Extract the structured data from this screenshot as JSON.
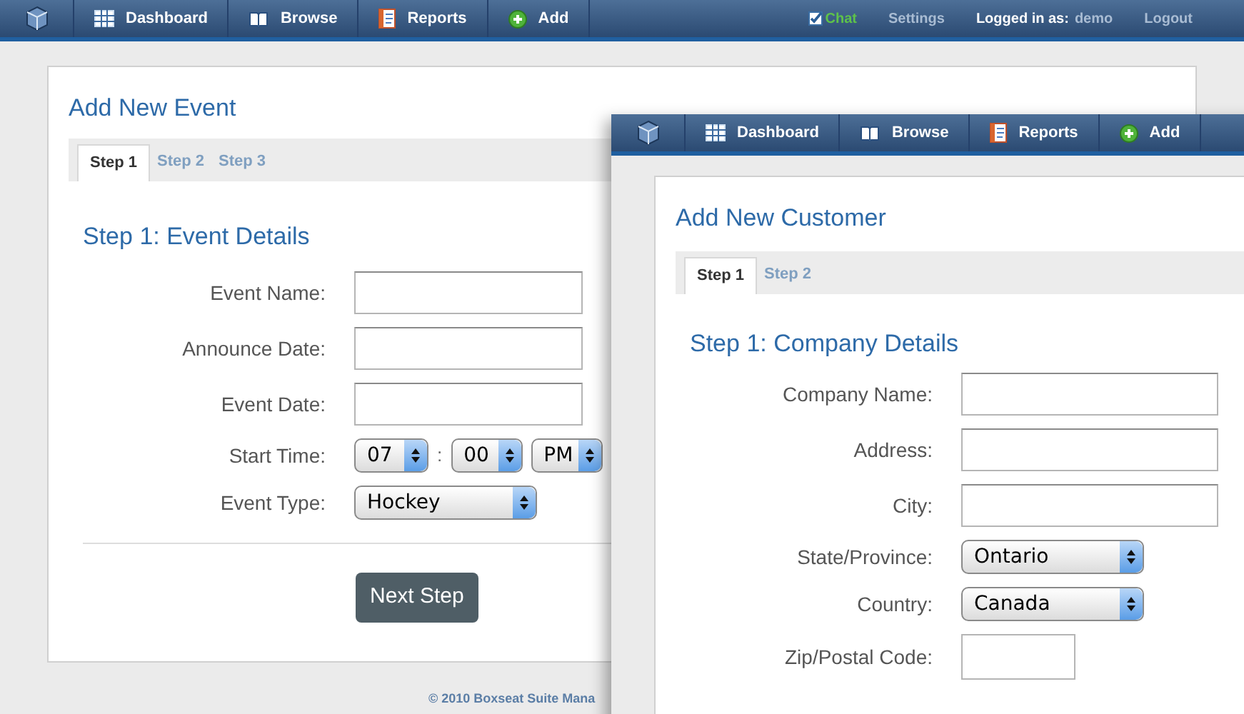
{
  "nav": {
    "items": [
      {
        "label": "Dashboard"
      },
      {
        "label": "Browse"
      },
      {
        "label": "Reports"
      },
      {
        "label": "Add"
      }
    ],
    "chat": "Chat",
    "settings": "Settings",
    "logged_in_label": "Logged in as:",
    "user": "demo",
    "logout": "Logout"
  },
  "event_form": {
    "title": "Add New Event",
    "tabs": [
      {
        "label": "Step 1",
        "selected": true
      },
      {
        "label": "Step 2",
        "selected": false
      },
      {
        "label": "Step 3",
        "selected": false
      }
    ],
    "section_title": "Step 1: Event Details",
    "fields": [
      {
        "label": "Event Name:",
        "kind": "text"
      },
      {
        "label": "Announce Date:",
        "kind": "text"
      },
      {
        "label": "Event Date:",
        "kind": "text"
      },
      {
        "label": "Start Time:",
        "kind": "time",
        "hour": "07",
        "separator": ":",
        "minute": "00",
        "period": "PM"
      },
      {
        "label": "Event Type:",
        "kind": "select",
        "value": "Hockey"
      }
    ],
    "button": "Next Step"
  },
  "footer": "© 2010 Boxseat Suite Mana",
  "customer_window": {
    "nav": {
      "items": [
        {
          "label": "Dashboard"
        },
        {
          "label": "Browse"
        },
        {
          "label": "Reports"
        },
        {
          "label": "Add"
        }
      ]
    },
    "title": "Add New Customer",
    "tabs": [
      {
        "label": "Step 1",
        "selected": true
      },
      {
        "label": "Step 2",
        "selected": false
      }
    ],
    "section_title": "Step 1: Company Details",
    "fields": [
      {
        "label": "Company Name:",
        "kind": "text"
      },
      {
        "label": "Address:",
        "kind": "text"
      },
      {
        "label": "City:",
        "kind": "text"
      },
      {
        "label": "State/Province:",
        "kind": "select",
        "value": "Ontario"
      },
      {
        "label": "Country:",
        "kind": "select",
        "value": "Canada"
      },
      {
        "label": "Zip/Postal Code:",
        "kind": "short"
      }
    ]
  }
}
